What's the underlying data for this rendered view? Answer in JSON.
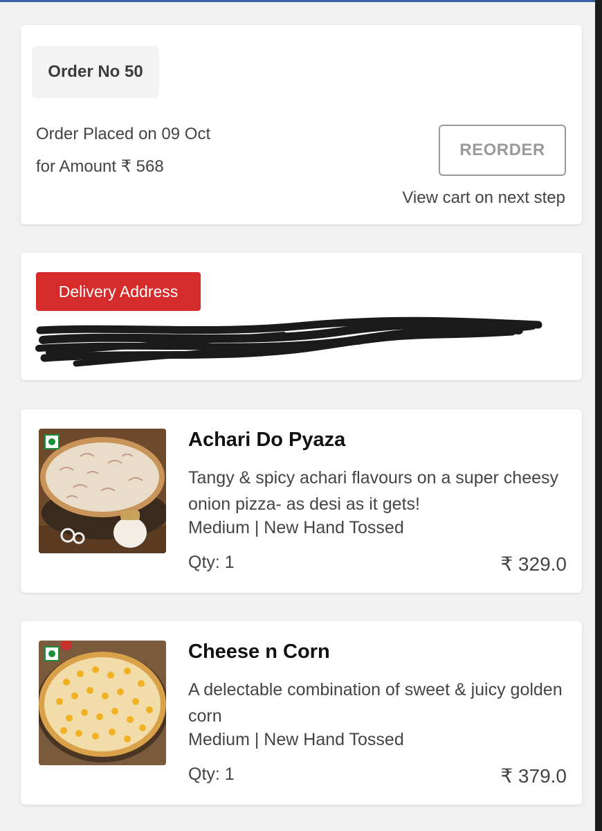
{
  "order": {
    "number_label": "Order No 50",
    "placed_label": "Order Placed on 09 Oct",
    "amount_label": "for Amount ₹ 568",
    "reorder_button": "REORDER",
    "cart_hint": "View cart on next step"
  },
  "address": {
    "badge_label": "Delivery Address"
  },
  "items": [
    {
      "name": "Achari Do Pyaza",
      "description": "Tangy & spicy achari flavours on a super cheesy onion pizza- as desi as it gets!",
      "variant": "Medium | New Hand Tossed",
      "qty": "Qty: 1",
      "price": "₹ 329.0",
      "icon": "veg-icon"
    },
    {
      "name": "Cheese n Corn",
      "description": "A delectable combination of sweet & juicy golden corn",
      "variant": "Medium | New Hand Tossed",
      "qty": "Qty: 1",
      "price": "₹ 379.0",
      "icon": "veg-icon"
    }
  ],
  "colors": {
    "accent_red": "#d52b2b",
    "veg_green": "#1a8f3a",
    "background": "#f1f1f1"
  }
}
